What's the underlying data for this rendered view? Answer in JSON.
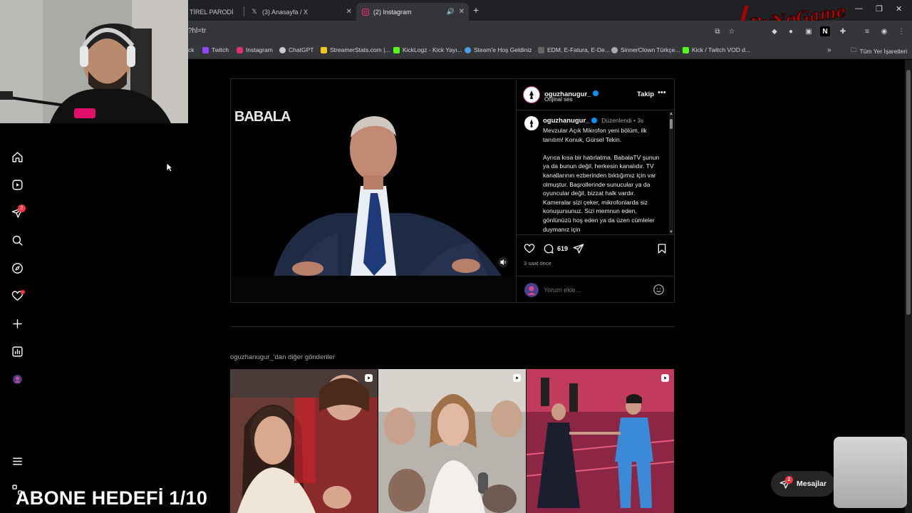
{
  "browser": {
    "tabs": [
      {
        "title": "TİREL PARODİ",
        "active": false
      },
      {
        "title": "(3) Anasayfa / X",
        "icon": "x-icon",
        "active": false
      },
      {
        "title": "(2) Instagram",
        "icon": "instagram-icon",
        "active": true
      }
    ],
    "url": "?hl=tr",
    "bookmarks": [
      {
        "label": "ck"
      },
      {
        "label": "Twitch",
        "color": "#9146ff"
      },
      {
        "label": "Instagram",
        "color": "#e1306c"
      },
      {
        "label": "ChatGPT",
        "color": "#cccccc"
      },
      {
        "label": "StreamerStats.com |...",
        "color": "#f5c518"
      },
      {
        "label": "KickLogz - Kick Yayı...",
        "color": "#53fc18"
      },
      {
        "label": "Steam'e Hoş Geldiniz",
        "color": "#4b9ce2"
      },
      {
        "label": "EDM, E-Fatura, E-De...",
        "color": "#888888"
      },
      {
        "label": "SinnerClown Türkçe...",
        "color": "#aaaaaa"
      },
      {
        "label": "Kick / Twitch VOD d...",
        "color": "#53fc18"
      }
    ],
    "all_bookmarks_label": "Tüm Yer İşaretleri"
  },
  "overlay": {
    "logo_text": "ByNoGame",
    "goal_text": "ABONE HEDEFİ 1/10"
  },
  "sidebar": {
    "notification_badge": "2"
  },
  "post": {
    "author": "oguzhanugur_",
    "audio": "Orijinal ses",
    "follow_label": "Takip",
    "video_brand": "BABALA",
    "caption_meta": "Düzenlendi • 3s",
    "caption": [
      "Mevzular Açık Mikrofon yeni bölüm, ilk tanıtım! Konuk, Gürsel Tekin.",
      "Ayrıca kısa bir hatırlatma. BabalaTV şunun ya da bunun değil, herkesin kanalıdır. TV kanallarının ezberinden bıktığımız için var olmuştur. Başrollerinde sunucular ya da oyuncular değil, bizzat halk vardır. Kameralar sizi çeker, mikrofonlarda siz konuşursunuz. Sizi memnun eden, gönlünüzü hoş eden ya da üzen cümleler duymanız için"
    ],
    "comment_count": "619",
    "time_ago": "3 saat önce",
    "comment_placeholder": "Yorum ekle..."
  },
  "more_posts": {
    "title": "oguzhanugur_'dan diğer gönderiler"
  },
  "messages": {
    "label": "Mesajlar",
    "badge": "2"
  }
}
